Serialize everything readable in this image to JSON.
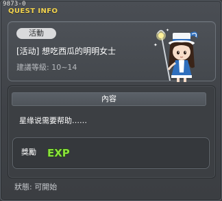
{
  "window": {
    "quest_id": "9873-0",
    "title": "QUEST INFO"
  },
  "quest": {
    "category_badge": "活動",
    "name": "[活动] 想吃西瓜的明明女士",
    "recommended_level": "建議等級: 10~14"
  },
  "content": {
    "header": "內容",
    "description": "星缘说需要帮助……"
  },
  "reward": {
    "label": "獎勵",
    "icon": "exp-icon",
    "icon_text": "EXP"
  },
  "status": {
    "text": "狀態:  可開始"
  },
  "colors": {
    "title": "#f2d34d",
    "exp_green": "#8be33a"
  }
}
